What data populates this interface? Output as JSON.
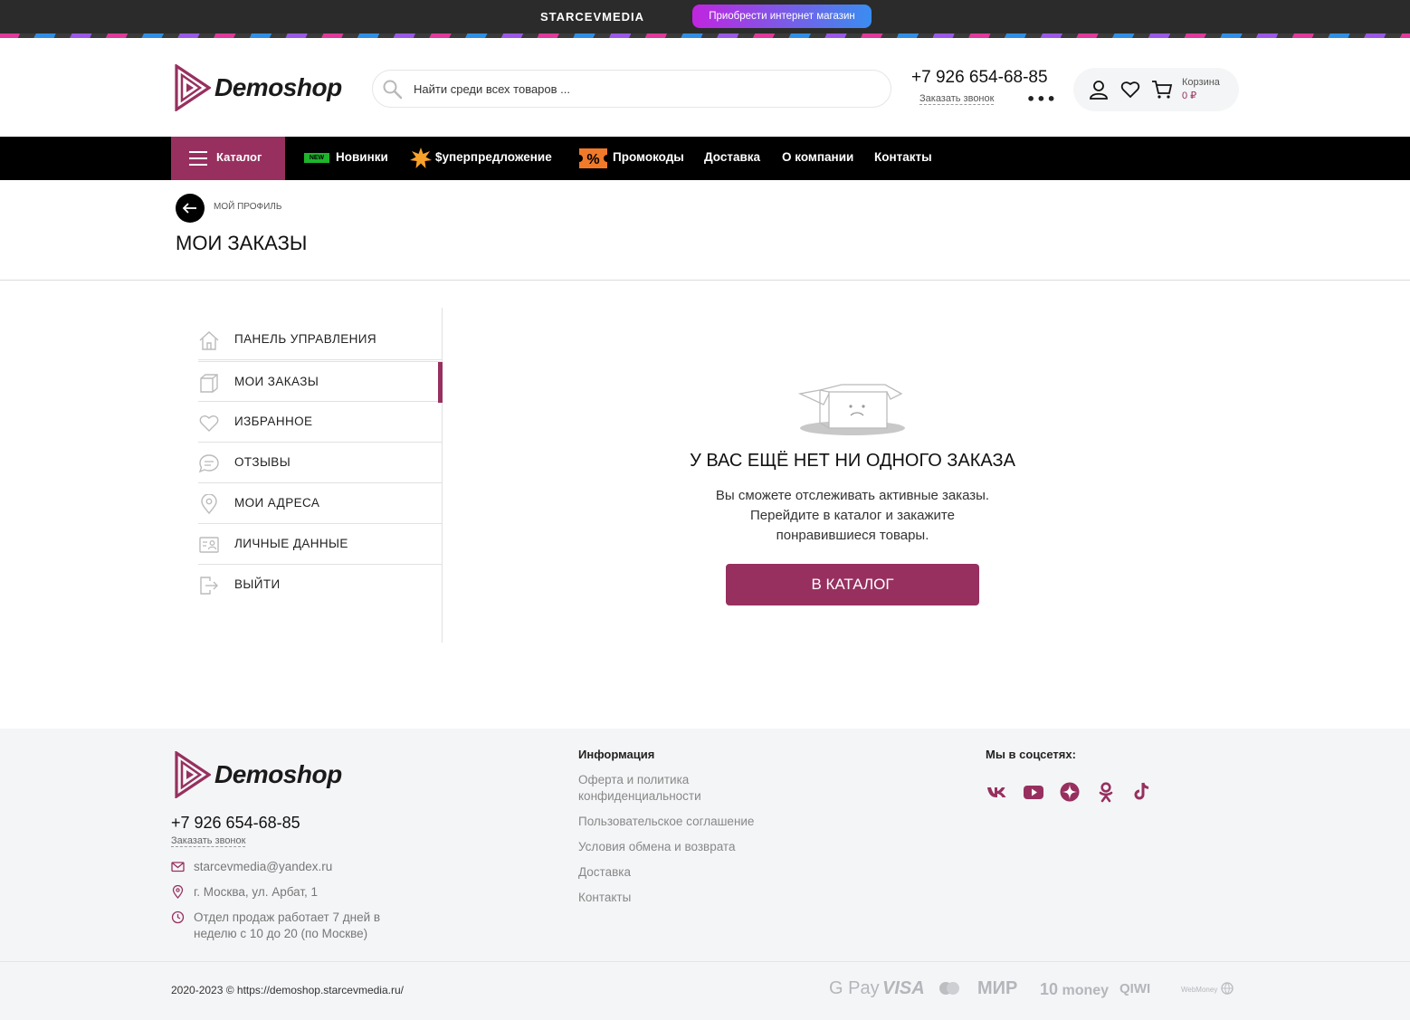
{
  "promo": {
    "brand": "STARCEVMEDIA",
    "button_label": "Приобрести интернет магазин"
  },
  "header": {
    "logo_text": "Demoshop",
    "search_placeholder": "Найти среди всех товаров ...",
    "phone": "+7 926 654-68-85",
    "callback_label": "Заказать звонок",
    "more_label": "•••",
    "cart_label": "Корзина",
    "cart_sum": "0 ₽"
  },
  "nav": {
    "catalog_label": "Каталог",
    "new_badge": "NEW",
    "items": [
      "Новинки",
      "$уперпредложение",
      "Промокоды",
      "Доставка",
      "О компании",
      "Контакты"
    ]
  },
  "breadcrumb": {
    "parent": "МОЙ ПРОФИЛЬ"
  },
  "page_title": "МОИ ЗАКАЗЫ",
  "sidebar": {
    "items": [
      {
        "label": "ПАНЕЛЬ УПРАВЛЕНИЯ",
        "icon": "home-icon",
        "active": false
      },
      {
        "label": "МОИ ЗАКАЗЫ",
        "icon": "box-icon",
        "active": true
      },
      {
        "label": "ИЗБРАННОЕ",
        "icon": "heart-icon",
        "active": false
      },
      {
        "label": "ОТЗЫВЫ",
        "icon": "chat-icon",
        "active": false
      },
      {
        "label": "МОИ АДРЕСА",
        "icon": "location-pin-icon",
        "active": false
      },
      {
        "label": "ЛИЧНЫЕ ДАННЫЕ",
        "icon": "id-card-icon",
        "active": false
      },
      {
        "label": "ВЫЙТИ",
        "icon": "logout-icon",
        "active": false
      }
    ]
  },
  "empty_state": {
    "title": "У ВАС ЕЩЁ НЕТ НИ ОДНОГО ЗАКАЗА",
    "text_line1": "Вы сможете отслеживать активные заказы.",
    "text_line2": "Перейдите в каталог и закажите",
    "text_line3": "понравившиеся товары.",
    "button_label": "В КАТАЛОГ"
  },
  "footer": {
    "logo_text": "Demoshop",
    "phone": "+7 926 654-68-85",
    "callback_label": "Заказать звонок",
    "email": "starcevmedia@yandex.ru",
    "address": "г. Москва, ул. Арбат, 1",
    "hours_line1": "Отдел продаж работает 7 дней в",
    "hours_line2": "неделю с 10 до 20 (по Москве)",
    "info_heading": "Информация",
    "info_links": [
      "Оферта и политика",
      "конфиденциальности",
      "Пользовательское соглашение",
      "Условия обмена и возврата",
      "Доставка",
      "Контакты"
    ],
    "social_heading": "Мы в соцсетях:",
    "social_icons": [
      "vk-icon",
      "youtube-icon",
      "dzen-icon",
      "odnoklassniki-icon",
      "tiktok-icon"
    ],
    "copyright": "2020-2023 © https://demoshop.starcevmedia.ru/",
    "payments": [
      "G Pay",
      "VISA",
      "MasterCard",
      "МИР",
      "money",
      "QIWI",
      "WebMoney"
    ]
  },
  "colors": {
    "accent": "#97305f",
    "nav_bg": "#000000",
    "promo_bg": "#2b2b2b",
    "footer_bg": "#f4f5f7"
  }
}
